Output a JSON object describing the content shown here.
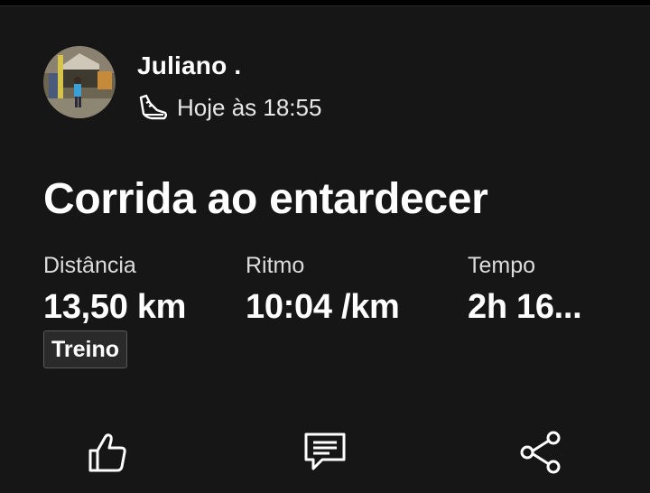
{
  "activity": {
    "athlete_name": "Juliano .",
    "activity_type_icon": "running-shoe-icon",
    "timestamp": "Hoje às 18:55",
    "title": "Corrida ao entardecer",
    "stats": [
      {
        "label": "Distância",
        "value": "13,50 km"
      },
      {
        "label": "Ritmo",
        "value": "10:04 /km"
      },
      {
        "label": "Tempo",
        "value": "2h 16..."
      }
    ],
    "tag": "Treino"
  },
  "actions": [
    {
      "name": "kudos",
      "icon": "thumbs-up-icon"
    },
    {
      "name": "comment",
      "icon": "comment-icon"
    },
    {
      "name": "share",
      "icon": "share-icon"
    }
  ],
  "colors": {
    "background": "#000000",
    "card": "#161616",
    "text": "#ffffff",
    "secondary_text": "#dcdcdc",
    "tag_border": "#5a5a5a"
  }
}
